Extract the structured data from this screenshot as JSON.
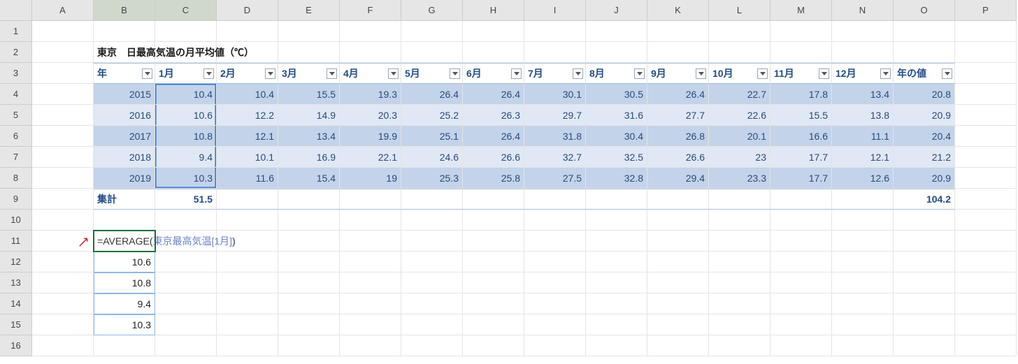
{
  "cols": [
    "A",
    "B",
    "C",
    "D",
    "E",
    "F",
    "G",
    "H",
    "I",
    "J",
    "K",
    "L",
    "M",
    "N",
    "O",
    "P"
  ],
  "rows": [
    "1",
    "2",
    "3",
    "4",
    "5",
    "6",
    "7",
    "8",
    "9",
    "10",
    "11",
    "12",
    "13",
    "14",
    "15",
    "16"
  ],
  "title": "東京　日最高気温の月平均値（℃）",
  "headers": [
    "年",
    "1月",
    "2月",
    "3月",
    "4月",
    "5月",
    "6月",
    "7月",
    "8月",
    "9月",
    "10月",
    "11月",
    "12月",
    "年の値"
  ],
  "table": [
    {
      "year": "2015",
      "vals": [
        "10.4",
        "10.4",
        "15.5",
        "19.3",
        "26.4",
        "26.4",
        "30.1",
        "30.5",
        "26.4",
        "22.7",
        "17.8",
        "13.4",
        "20.8"
      ]
    },
    {
      "year": "2016",
      "vals": [
        "10.6",
        "12.2",
        "14.9",
        "20.3",
        "25.2",
        "26.3",
        "29.7",
        "31.6",
        "27.7",
        "22.6",
        "15.5",
        "13.8",
        "20.9"
      ]
    },
    {
      "year": "2017",
      "vals": [
        "10.8",
        "12.1",
        "13.4",
        "19.9",
        "25.1",
        "26.4",
        "31.8",
        "30.4",
        "26.8",
        "20.1",
        "16.6",
        "11.1",
        "20.4"
      ]
    },
    {
      "year": "2018",
      "vals": [
        "9.4",
        "10.1",
        "16.9",
        "22.1",
        "24.6",
        "26.6",
        "32.7",
        "32.5",
        "26.6",
        "23",
        "17.7",
        "12.1",
        "21.2"
      ]
    },
    {
      "year": "2019",
      "vals": [
        "10.3",
        "11.6",
        "15.4",
        "19",
        "25.3",
        "25.8",
        "27.5",
        "32.8",
        "29.4",
        "23.3",
        "17.7",
        "12.6",
        "20.9"
      ]
    }
  ],
  "totalLabel": "集計",
  "totals": {
    "jan": "51.5",
    "year": "104.2"
  },
  "formula": {
    "eq": "=",
    "fn": "AVERAGE(",
    "ref": "東京最高気温[1月]",
    "close": ")"
  },
  "spill": [
    "10.6",
    "10.8",
    "9.4",
    "10.3"
  ],
  "chart_data": {
    "type": "table",
    "title": "東京　日最高気温の月平均値（℃）",
    "columns": [
      "年",
      "1月",
      "2月",
      "3月",
      "4月",
      "5月",
      "6月",
      "7月",
      "8月",
      "9月",
      "10月",
      "11月",
      "12月",
      "年の値"
    ],
    "rows": [
      [
        2015,
        10.4,
        10.4,
        15.5,
        19.3,
        26.4,
        26.4,
        30.1,
        30.5,
        26.4,
        22.7,
        17.8,
        13.4,
        20.8
      ],
      [
        2016,
        10.6,
        12.2,
        14.9,
        20.3,
        25.2,
        26.3,
        29.7,
        31.6,
        27.7,
        22.6,
        15.5,
        13.8,
        20.9
      ],
      [
        2017,
        10.8,
        12.1,
        13.4,
        19.9,
        25.1,
        26.4,
        31.8,
        30.4,
        26.8,
        20.1,
        16.6,
        11.1,
        20.4
      ],
      [
        2018,
        9.4,
        10.1,
        16.9,
        22.1,
        24.6,
        26.6,
        32.7,
        32.5,
        26.6,
        23,
        17.7,
        12.1,
        21.2
      ],
      [
        2019,
        10.3,
        11.6,
        15.4,
        19,
        25.3,
        25.8,
        27.5,
        32.8,
        29.4,
        23.3,
        17.7,
        12.6,
        20.9
      ]
    ],
    "totals": {
      "1月": 51.5,
      "年の値": 104.2
    }
  }
}
